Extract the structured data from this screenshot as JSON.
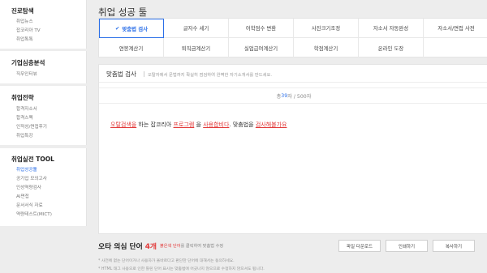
{
  "sidebar": {
    "sections": [
      {
        "title": "진로탐색",
        "items": [
          "취업뉴스",
          "잡코리아 TV",
          "취업톡톡"
        ]
      },
      {
        "title": "기업심층분석",
        "items": [
          "직무인터뷰"
        ]
      },
      {
        "title": "취업전략",
        "items": [
          "합격자소서",
          "합격스펙",
          "인적성/면접후기",
          "취업특강"
        ]
      },
      {
        "title": "취업실전 TOOL",
        "items": [
          "취업성공툴",
          "공기업 모의고사",
          "인성역량검사",
          "AI면접",
          "문서서식 자료",
          "역량테스트(MICT)"
        ],
        "active_index": 0
      }
    ]
  },
  "main": {
    "title": "취업 성공 툴",
    "tools_row1": [
      "맞춤법 검사",
      "글자수 세기",
      "어학점수 변환",
      "사진크기조정",
      "자소서 자동완성",
      "자소서/면접 사전"
    ],
    "tools_row2": [
      "연봉계산기",
      "퇴직금계산기",
      "실업급여계산기",
      "학점계산기",
      "온라인 도장"
    ],
    "active_tool_check": "✔"
  },
  "checker": {
    "title": "맞춤법 검사",
    "description": "오탈자에서 문법까지 확실히 점검하여 완벽한 자기소개서를 만드세요.",
    "count_prefix": "총 ",
    "count_num": "39",
    "count_suffix": "자 / 500자",
    "sentence": {
      "e1": "오탈검색을",
      "t1": " 하는 잡코리아 ",
      "e2": "프로그렘",
      "t2": " 을 ",
      "e3": "사용합비다",
      "t3": ". 맞춤법을 ",
      "e4": "검사해볼가요"
    }
  },
  "errors": {
    "title_prefix": "오타 의심 단어 ",
    "count": "4개",
    "hint_red": "붉은색 단어",
    "hint_rest": "를 클릭하여 맞춤법 수정"
  },
  "buttons": {
    "download": "파일 다운로드",
    "print": "인쇄하기",
    "copy": "복사하기"
  },
  "notes": [
    "* 사전에 없는 단어이거나 사용자가 올바르다고 판단한 단어에 대해서는 동의하세요.",
    "* HTML 태그 사용으로 인한 틀린 단어 표시는 맞춤법에 어긋나지 않으므로 수정하지 않으셔도 됩니다."
  ],
  "colors": {
    "accent": "#2b6fe8",
    "error": "#e23a3a"
  }
}
